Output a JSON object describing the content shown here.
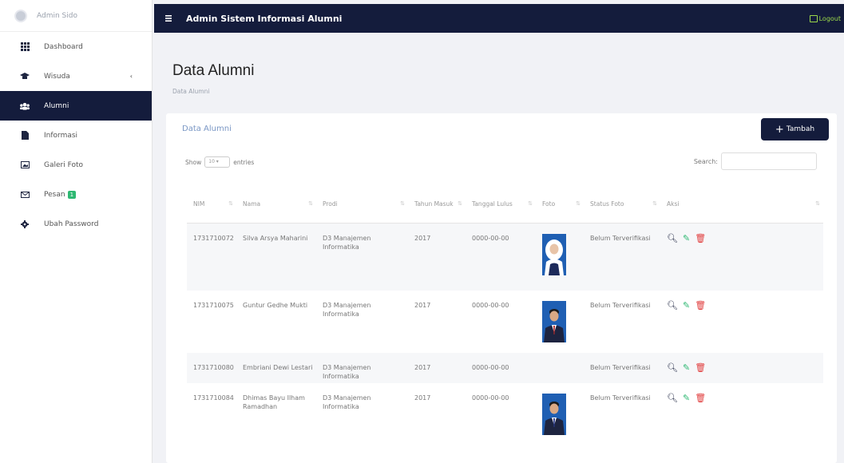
{
  "sidebar": {
    "user": "Admin Sido",
    "items": [
      {
        "label": "Dashboard",
        "icon": "grid-icon"
      },
      {
        "label": "Wisuda",
        "icon": "graduation-cap-icon",
        "caret": "‹"
      },
      {
        "label": "Alumni",
        "icon": "users-icon",
        "active": true
      },
      {
        "label": "Informasi",
        "icon": "file-icon"
      },
      {
        "label": "Galeri Foto",
        "icon": "image-icon"
      },
      {
        "label": "Pesan",
        "icon": "envelope-icon",
        "badge": "1"
      },
      {
        "label": "Ubah Password",
        "icon": "gear-icon"
      }
    ]
  },
  "topbar": {
    "title": "Admin Sistem Informasi Alumni",
    "logout_label": "Logout"
  },
  "page": {
    "title": "Data Alumni",
    "breadcrumb": "Data Alumni"
  },
  "card": {
    "title": "Data Alumni",
    "add_label": "Tambah",
    "show_prefix": "Show",
    "show_value": "10",
    "show_suffix": "entries",
    "search_label": "Search:",
    "search_placeholder": ""
  },
  "table": {
    "headers": [
      "NIM",
      "Nama",
      "Prodi",
      "Tahun Masuk",
      "Tanggal Lulus",
      "Foto",
      "Status Foto",
      "Aksi"
    ],
    "rows": [
      {
        "nim": "1731710072",
        "nama": "Silva Arsya Maharini",
        "prodi": "D3 Manajemen Informatika",
        "masuk": "2017",
        "lulus": "0000-00-00",
        "foto": "female",
        "status": "Belum Terverifikasi"
      },
      {
        "nim": "1731710075",
        "nama": "Guntur Gedhe Mukti",
        "prodi": "D3 Manajemen Informatika",
        "masuk": "2017",
        "lulus": "0000-00-00",
        "foto": "male",
        "status": "Belum Terverifikasi"
      },
      {
        "nim": "1731710080",
        "nama": "Embriani Dewi Lestari",
        "prodi": "D3 Manajemen Informatika",
        "masuk": "2017",
        "lulus": "0000-00-00",
        "foto": "",
        "status": "Belum Terverifikasi"
      },
      {
        "nim": "1731710084",
        "nama": "Dhimas Bayu Ilham Ramadhan",
        "prodi": "D3 Manajemen Informatika",
        "masuk": "2017",
        "lulus": "0000-00-00",
        "foto": "male",
        "status": "Belum Terverifikasi"
      }
    ]
  },
  "colors": {
    "navy": "#141c3c",
    "green": "#2eb872",
    "red": "#e03b3b",
    "photo_bg": "#1f5fb3"
  }
}
